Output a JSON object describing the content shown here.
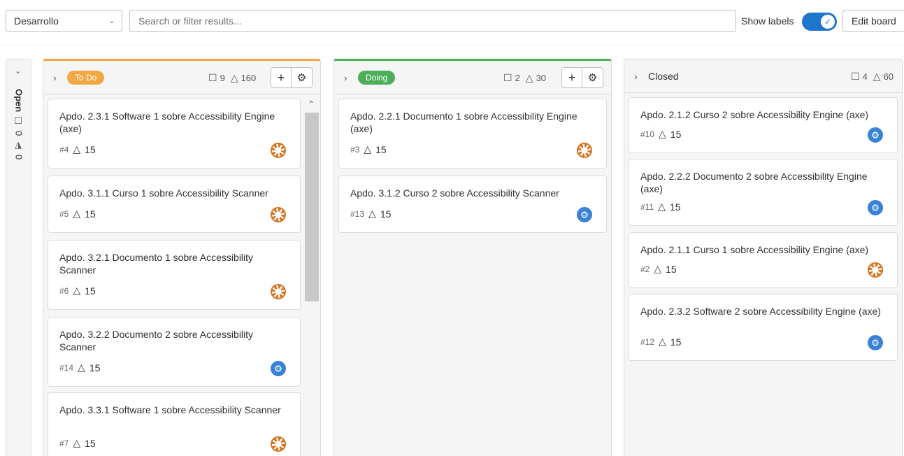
{
  "topbar": {
    "board_name": "Desarrollo",
    "search_placeholder": "Search or filter results...",
    "show_labels": "Show labels",
    "show_labels_on": true,
    "edit_board": "Edit board"
  },
  "collapsed": {
    "name": "Open",
    "issue_count": "0",
    "weight": "0"
  },
  "lists": {
    "todo": {
      "label": "To Do",
      "color": "#f0a744",
      "issue_count": "9",
      "weight": "160",
      "cards": [
        {
          "title": "Apdo. 2.3.1 Software 1 sobre Accessibility Engine (axe)",
          "num": "#4",
          "weight": "15",
          "avatar": "orange"
        },
        {
          "title": "Apdo. 3.1.1 Curso 1 sobre Accessibility Scanner",
          "num": "#5",
          "weight": "15",
          "avatar": "orange"
        },
        {
          "title": "Apdo. 3.2.1 Documento 1 sobre Accessibility Scanner",
          "num": "#6",
          "weight": "15",
          "avatar": "orange"
        },
        {
          "title": "Apdo. 3.2.2 Documento 2 sobre Accessibility Scanner",
          "num": "#14",
          "weight": "15",
          "avatar": "blue"
        },
        {
          "title": "Apdo. 3.3.1 Software 1 sobre Accessibility Scanner",
          "num": "#7",
          "weight": "15",
          "avatar": "orange"
        }
      ]
    },
    "doing": {
      "label": "Doing",
      "color": "#4cae58",
      "issue_count": "2",
      "weight": "30",
      "cards": [
        {
          "title": "Apdo. 2.2.1 Documento 1 sobre Accessibility Engine (axe)",
          "num": "#3",
          "weight": "15",
          "avatar": "orange"
        },
        {
          "title": "Apdo. 3.1.2 Curso 2 sobre Accessibility Scanner",
          "num": "#13",
          "weight": "15",
          "avatar": "blue"
        }
      ]
    },
    "closed": {
      "label": "Closed",
      "issue_count": "4",
      "weight": "60",
      "cards": [
        {
          "title": "Apdo. 2.1.2 Curso 2 sobre Accessibility Engine (axe)",
          "num": "#10",
          "weight": "15",
          "avatar": "blue"
        },
        {
          "title": "Apdo. 2.2.2 Documento 2 sobre Accessibility Engine (axe)",
          "num": "#11",
          "weight": "15",
          "avatar": "blue"
        },
        {
          "title": "Apdo. 2.1.1 Curso 1 sobre Accessibility Engine (axe)",
          "num": "#2",
          "weight": "15",
          "avatar": "orange"
        },
        {
          "title": "Apdo. 2.3.2 Software 2 sobre Accessibility Engine (axe)",
          "num": "#12",
          "weight": "15",
          "avatar": "blue"
        }
      ]
    }
  },
  "icons": {
    "chevron_down": "chevron-down-icon",
    "chevron_right": "chevron-right-icon",
    "issues": "issues-icon",
    "weight": "weight-icon",
    "plus": "plus-icon",
    "gear": "gear-icon",
    "check": "check-icon"
  }
}
